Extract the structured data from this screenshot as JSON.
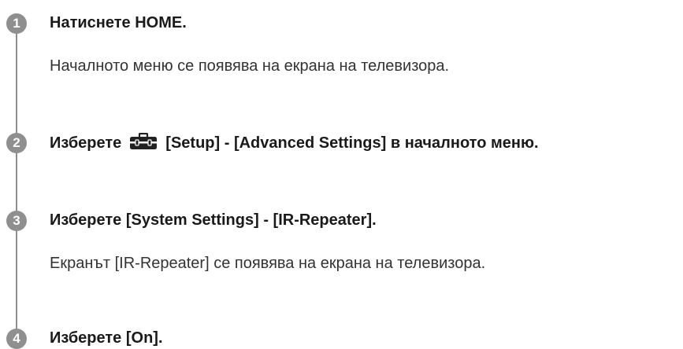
{
  "steps": [
    {
      "number": "1",
      "title": "Натиснете HOME.",
      "description": "Началното меню се появява на екрана на телевизора."
    },
    {
      "number": "2",
      "title_prefix": "Изберете",
      "icon": "toolbox-icon",
      "title_suffix": "[Setup] - [Advanced Settings] в началното меню."
    },
    {
      "number": "3",
      "title": "Изберете [System Settings] - [IR-Repeater].",
      "description": "Екранът [IR-Repeater] се появява на екрана на телевизора."
    },
    {
      "number": "4",
      "title": "Изберете [On]."
    }
  ],
  "colors": {
    "badge": "#8f8f8f",
    "line": "#8f8f8f",
    "text": "#1a1a1a"
  }
}
